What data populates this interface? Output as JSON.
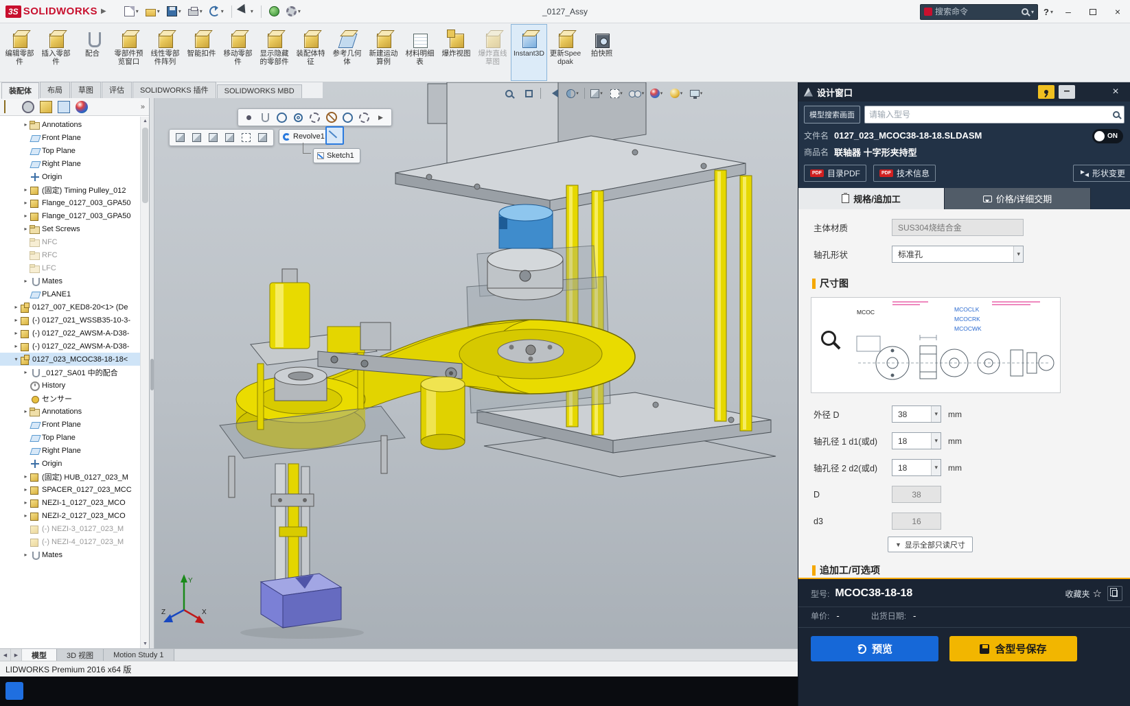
{
  "titlebar": {
    "logo_mark": "3S",
    "logo_text": "SOLIDWORKS",
    "title": "_0127_Assy",
    "search_placeholder": "搜索命令",
    "help_label": "?"
  },
  "ribbon": [
    {
      "label": "编辑零部件",
      "icon": "edit-component"
    },
    {
      "label": "插入零部件",
      "icon": "insert-component"
    },
    {
      "label": "配合",
      "icon": "mate"
    },
    {
      "label": "零部件预览窗口",
      "icon": "component-preview"
    },
    {
      "label": "线性零部件阵列",
      "icon": "linear-pattern"
    },
    {
      "label": "智能扣件",
      "icon": "smart-fasteners"
    },
    {
      "label": "移动零部件",
      "icon": "move-component"
    },
    {
      "label": "显示隐藏的零部件",
      "icon": "show-hidden"
    },
    {
      "label": "装配体特征",
      "icon": "assembly-features"
    },
    {
      "label": "参考几何体",
      "icon": "reference-geometry"
    },
    {
      "label": "新建运动算例",
      "icon": "motion-study"
    },
    {
      "label": "材料明细表",
      "icon": "bom"
    },
    {
      "label": "爆炸视图",
      "icon": "exploded-view"
    },
    {
      "label": "爆炸直线草图",
      "icon": "explode-lines",
      "grayed": true
    },
    {
      "label": "Instant3D",
      "icon": "instant3d",
      "active": true
    },
    {
      "label": "更新Speedpak",
      "icon": "update-speedpak"
    },
    {
      "label": "拍快照",
      "icon": "snapshot"
    }
  ],
  "command_tabs": [
    {
      "label": "装配体",
      "active": true
    },
    {
      "label": "布局"
    },
    {
      "label": "草图"
    },
    {
      "label": "评估"
    },
    {
      "label": "SOLIDWORKS 插件"
    },
    {
      "label": "SOLIDWORKS MBD"
    }
  ],
  "feature_tree": [
    {
      "label": "Annotations",
      "icon": "folder-a",
      "level": 2,
      "arrow": "r"
    },
    {
      "label": "Front Plane",
      "icon": "plane",
      "level": 2
    },
    {
      "label": "Top Plane",
      "icon": "plane",
      "level": 2
    },
    {
      "label": "Right Plane",
      "icon": "plane",
      "level": 2
    },
    {
      "label": "Origin",
      "icon": "origin",
      "level": 2
    },
    {
      "label": "(固定) Timing Pulley_012",
      "icon": "part",
      "level": 2,
      "arrow": "r"
    },
    {
      "label": "Flange_0127_003_GPA50",
      "icon": "part",
      "level": 2,
      "arrow": "r"
    },
    {
      "label": "Flange_0127_003_GPA50",
      "icon": "part",
      "level": 2,
      "arrow": "r"
    },
    {
      "label": "Set Screws",
      "icon": "folder",
      "level": 2,
      "arrow": "r"
    },
    {
      "label": "NFC",
      "icon": "folder",
      "level": 2,
      "grayed": true
    },
    {
      "label": "RFC",
      "icon": "folder",
      "level": 2,
      "grayed": true
    },
    {
      "label": "LFC",
      "icon": "folder",
      "level": 2,
      "grayed": true
    },
    {
      "label": "Mates",
      "icon": "clip",
      "level": 2,
      "arrow": "r"
    },
    {
      "label": "PLANE1",
      "icon": "plane",
      "level": 2
    },
    {
      "label": "0127_007_KED8-20<1> (De",
      "icon": "asm",
      "level": 1,
      "arrow": "r"
    },
    {
      "label": "(-) 0127_021_WSSB35-10-3-",
      "icon": "part",
      "level": 1,
      "arrow": "r"
    },
    {
      "label": "(-) 0127_022_AWSM-A-D38-",
      "icon": "part",
      "level": 1,
      "arrow": "r"
    },
    {
      "label": "(-) 0127_022_AWSM-A-D38-",
      "icon": "part",
      "level": 1,
      "arrow": "r"
    },
    {
      "label": "0127_023_MCOC38-18-18<",
      "icon": "asm",
      "level": 1,
      "arrow": "d",
      "selected": true
    },
    {
      "label": "_0127_SA01 中的配合",
      "icon": "clip",
      "level": 2,
      "arrow": "r"
    },
    {
      "label": "History",
      "icon": "history",
      "level": 2
    },
    {
      "label": "センサー",
      "icon": "sensor",
      "level": 2
    },
    {
      "label": "Annotations",
      "icon": "folder-a",
      "level": 2,
      "arrow": "r"
    },
    {
      "label": "Front Plane",
      "icon": "plane",
      "level": 2
    },
    {
      "label": "Top Plane",
      "icon": "plane",
      "level": 2
    },
    {
      "label": "Right Plane",
      "icon": "plane",
      "level": 2
    },
    {
      "label": "Origin",
      "icon": "origin",
      "level": 2
    },
    {
      "label": "(固定) HUB_0127_023_M",
      "icon": "part",
      "level": 2,
      "arrow": "r"
    },
    {
      "label": "SPACER_0127_023_MCC",
      "icon": "part",
      "level": 2,
      "arrow": "r"
    },
    {
      "label": "NEZI-1_0127_023_MCO",
      "icon": "part",
      "level": 2,
      "arrow": "r"
    },
    {
      "label": "NEZI-2_0127_023_MCO",
      "icon": "part",
      "level": 2,
      "arrow": "r"
    },
    {
      "label": "(-) NEZI-3_0127_023_M",
      "icon": "part",
      "level": 2,
      "grayed": true
    },
    {
      "label": "(-) NEZI-4_0127_023_M",
      "icon": "part",
      "level": 2,
      "grayed": true
    },
    {
      "label": "Mates",
      "icon": "clip",
      "level": 2,
      "arrow": "r"
    }
  ],
  "viewport": {
    "revolve_chip": "Revolve1",
    "sketch_chip": "Sketch1",
    "triad_x": "X",
    "triad_y": "Y",
    "triad_z": "Z"
  },
  "right_panel": {
    "title": "设计窗口",
    "search_button": "模型搜索画面",
    "search_placeholder": "请输入型号",
    "toggle_on": "ON",
    "file_label": "文件名",
    "file_value": "0127_023_MCOC38-18-18.SLDASM",
    "product_label": "商品名",
    "product_value": "联轴器 十字形夹持型",
    "catalog_pdf": "目录PDF",
    "tech_info": "技术信息",
    "shape_change": "形状变更",
    "tab_spec": "规格/追加工",
    "tab_price": "价格/详细交期",
    "material_label": "主体材质",
    "material_value": "SUS304烧结合金",
    "hole_label": "轴孔形状",
    "hole_value": "标准孔",
    "dim_section": "尺寸图",
    "drawing_labels": [
      "MCOC",
      "MCOCLK",
      "MCOCRK",
      "MCOCWK"
    ],
    "dim_selects": [
      {
        "label": "外径 D",
        "value": "38",
        "unit": "mm"
      },
      {
        "label": "轴孔径 1 d1(或d)",
        "value": "18",
        "unit": "mm"
      },
      {
        "label": "轴孔径 2 d2(或d)",
        "value": "18",
        "unit": "mm"
      }
    ],
    "dim_readonly": [
      {
        "label": "D",
        "value": "38"
      },
      {
        "label": "d3",
        "value": "16"
      }
    ],
    "show_all": "显示全部只读尺寸",
    "addon_section": "追加工/可选项",
    "model_label": "型号:",
    "model_value": "MCOC38-18-18",
    "favorites": "收藏夹",
    "unit_price_label": "单价:",
    "unit_price_value": "-",
    "ship_label": "出货日期:",
    "ship_value": "-",
    "preview": "预览",
    "save": "含型号保存"
  },
  "statusbar": {
    "tabs": [
      {
        "label": "模型",
        "active": true
      },
      {
        "label": "3D 视图"
      },
      {
        "label": "Motion Study 1"
      }
    ],
    "status_text": "LIDWORKS Premium 2016 x64 版"
  },
  "colors": {
    "accent_orange": "#f5a800",
    "preview_blue": "#1668d8",
    "save_yellow": "#f2b600",
    "logo_red": "#c8102e",
    "part_yellow": "#e8da00",
    "part_blue": "#3f8ccc",
    "part_purple": "#7b80d6"
  }
}
